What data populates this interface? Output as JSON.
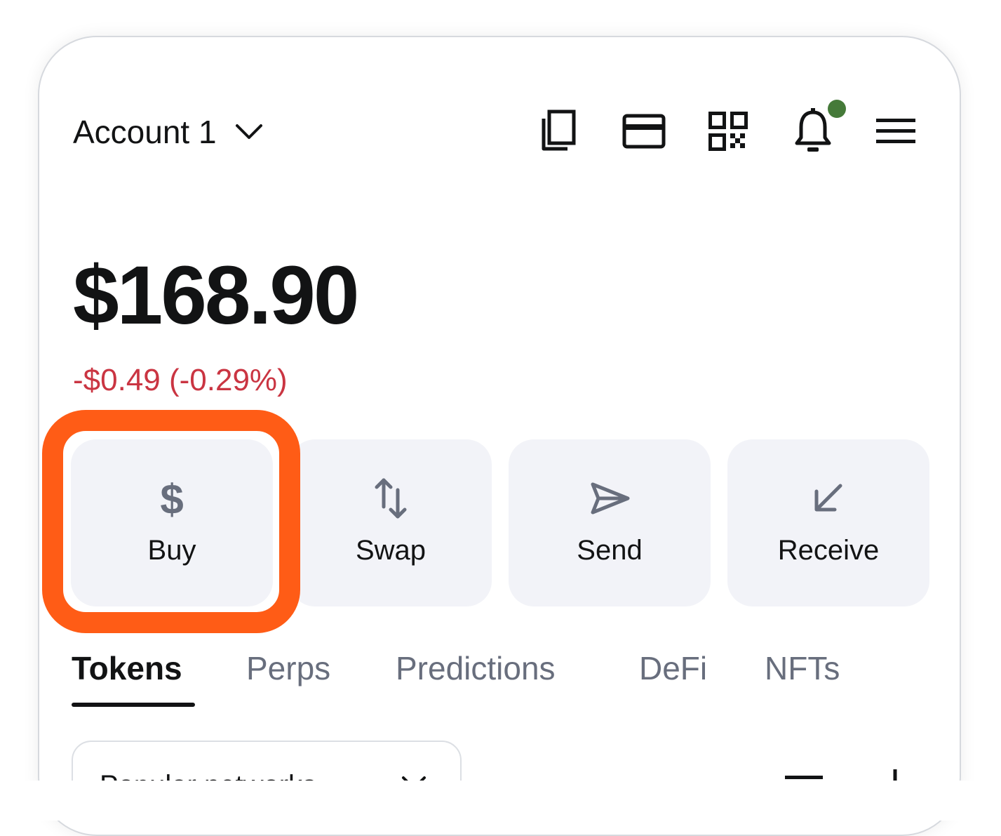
{
  "header": {
    "account_label": "Account 1",
    "icons": [
      "copy-icon",
      "card-icon",
      "qr-code-icon",
      "bell-icon",
      "menu-icon"
    ],
    "notification_dot_color": "#457a39"
  },
  "balance": {
    "total": "$168.90",
    "change": "-$0.49 (-0.29%)",
    "change_color": "#ca3542"
  },
  "actions": [
    {
      "label": "Buy",
      "icon": "dollar-icon"
    },
    {
      "label": "Swap",
      "icon": "swap-arrows-icon"
    },
    {
      "label": "Send",
      "icon": "send-icon"
    },
    {
      "label": "Receive",
      "icon": "receive-arrow-icon"
    }
  ],
  "highlight_color": "#ff5c16",
  "tabs": [
    {
      "label": "Tokens",
      "active": true
    },
    {
      "label": "Perps",
      "active": false
    },
    {
      "label": "Predictions",
      "active": false
    },
    {
      "label": "DeFi",
      "active": false
    },
    {
      "label": "NFTs",
      "active": false
    }
  ],
  "filter": {
    "network_label": "Popular networks",
    "icons": [
      "sort-icon",
      "add-icon"
    ]
  }
}
